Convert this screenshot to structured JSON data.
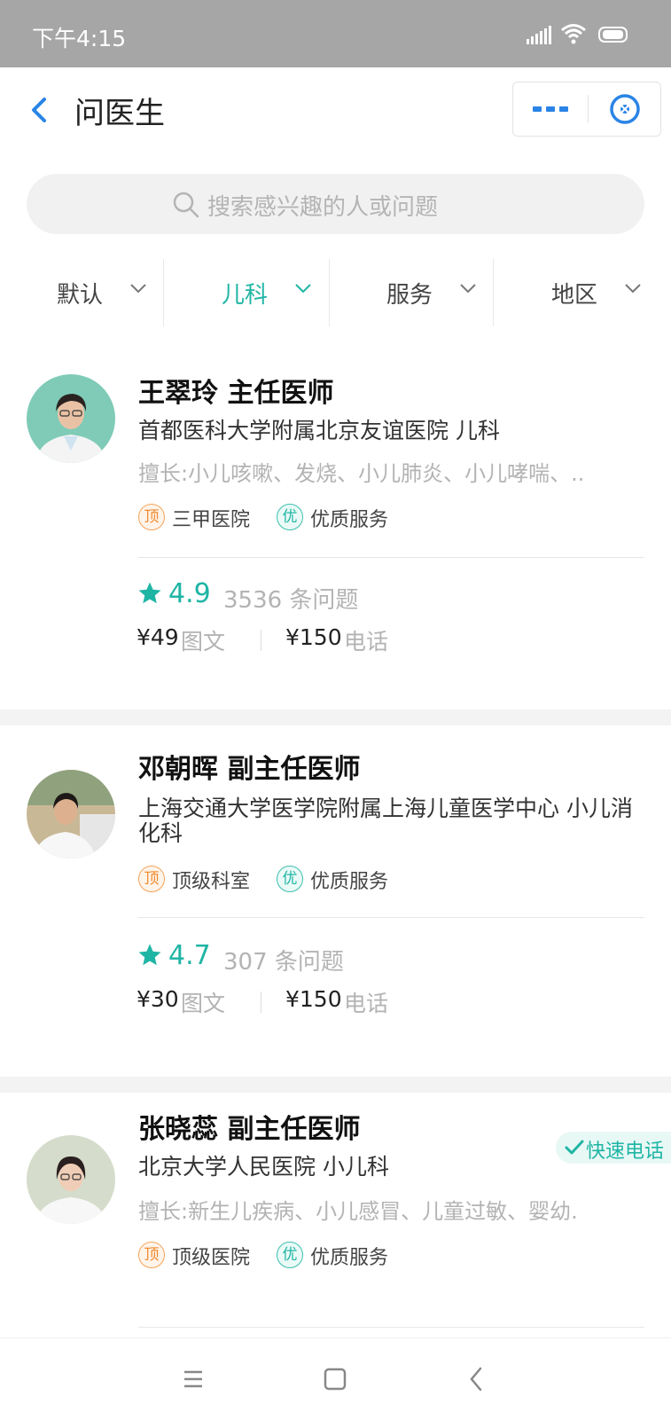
{
  "status": {
    "time": "下午4:15"
  },
  "nav": {
    "title": "问医生"
  },
  "search": {
    "placeholder": "搜索感兴趣的人或问题"
  },
  "filters": [
    {
      "label": "默认",
      "active": false
    },
    {
      "label": "儿科",
      "active": true
    },
    {
      "label": "服务",
      "active": false
    },
    {
      "label": "地区",
      "active": false
    }
  ],
  "doctors": [
    {
      "name": "王翠玲 主任医师",
      "hospital": "首都医科大学附属北京友谊医院 儿科",
      "expertise": "擅长:小儿咳嗽、发烧、小儿肺炎、小儿哮喘、..",
      "badge1_icon": "顶",
      "badge1_text": "三甲医院",
      "badge2_icon": "优",
      "badge2_text": "优质服务",
      "rating": "4.9",
      "questions": "3536 条问题",
      "price_text": "¥49",
      "text_label": "图文",
      "price_phone": "¥150",
      "phone_label": "电话"
    },
    {
      "name": "邓朝晖 副主任医师",
      "hospital": "上海交通大学医学院附属上海儿童医学中心 小儿消化科",
      "badge1_icon": "顶",
      "badge1_text": "顶级科室",
      "badge2_icon": "优",
      "badge2_text": "优质服务",
      "rating": "4.7",
      "questions": "307 条问题",
      "price_text": "¥30",
      "text_label": "图文",
      "price_phone": "¥150",
      "phone_label": "电话"
    },
    {
      "name": "张晓蕊 副主任医师",
      "hospital": "北京大学人民医院 小儿科",
      "expertise": "擅长:新生儿疾病、小儿感冒、儿童过敏、婴幼.",
      "badge1_icon": "顶",
      "badge1_text": "顶级医院",
      "badge2_icon": "优",
      "badge2_text": "优质服务",
      "fast_tag": "快速电话"
    }
  ],
  "colors": {
    "accent": "#1fb5a5",
    "nav_blue": "#2a84e6",
    "badge_orange": "#f08a2e",
    "statusbar": "#a6a6a6"
  }
}
